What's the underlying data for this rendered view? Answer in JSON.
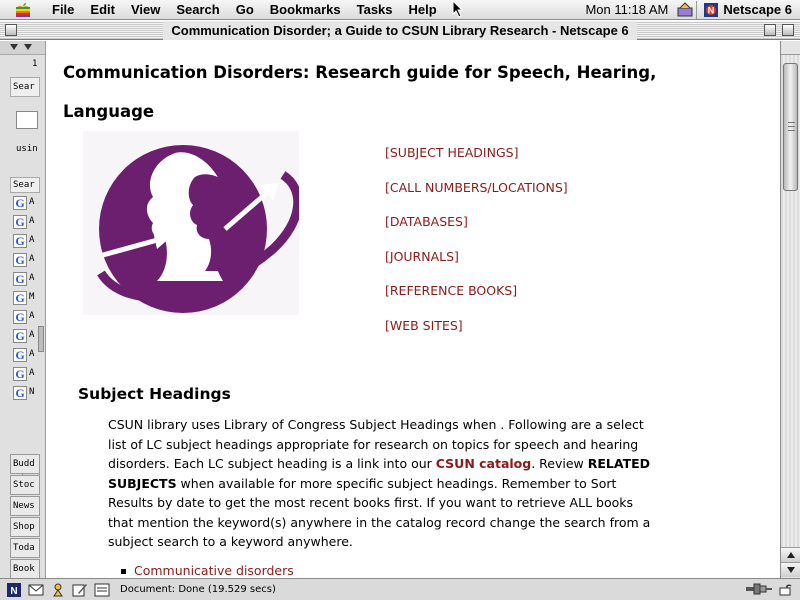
{
  "menubar": {
    "items": [
      "File",
      "Edit",
      "View",
      "Search",
      "Go",
      "Bookmarks",
      "Tasks",
      "Help"
    ],
    "clock": "Mon 11:18 AM",
    "app_name": "Netscape 6"
  },
  "window": {
    "title": "Communication Disorder; a Guide to CSUN Library Research - Netscape 6"
  },
  "sidebar": {
    "top_text": "1",
    "search_label": "Sear",
    "using_label": "usin",
    "results_label": "Sear",
    "results": [
      {
        "letter": "A"
      },
      {
        "letter": "A"
      },
      {
        "letter": "A"
      },
      {
        "letter": "A"
      },
      {
        "letter": "A"
      },
      {
        "letter": "M"
      },
      {
        "letter": "A"
      },
      {
        "letter": "A"
      },
      {
        "letter": "A"
      },
      {
        "letter": "A"
      },
      {
        "letter": "N"
      }
    ],
    "tabs": [
      "Budd",
      "Stoc",
      "News",
      "Shop",
      "Toda",
      "Book"
    ]
  },
  "page": {
    "title": "Communication Disorders: Research guide for Speech, Hearing, Language",
    "links": [
      "[SUBJECT HEADINGS]",
      "[CALL NUMBERS/LOCATIONS]",
      "[DATABASES]",
      "[JOURNALS]",
      "[REFERENCE BOOKS]",
      "[WEB SITES]"
    ],
    "section_title": "Subject Headings",
    "para_1": "CSUN library uses Library of Congress Subject Headings when . Following are a select list of LC subject headings appropriate for research on topics for speech and hearing disorders. Each LC subject heading is a link into our ",
    "catalog_link": "CSUN catalog",
    "para_2": ". Review ",
    "related": "RELATED SUBJECTS",
    "para_3": " when available for more specific subject headings. Remember to Sort Results by date to get the most recent books first. If you want to retrieve ALL books that mention the keyword(s) anywhere in the catalog record change the search from a subject search to a keyword anywhere.",
    "bullets": [
      "Communicative disorders"
    ]
  },
  "status": {
    "text": "Document: Done (19.529 secs)"
  },
  "colors": {
    "link": "#8b1a1a",
    "logo_purple": "#6b1f6e"
  }
}
